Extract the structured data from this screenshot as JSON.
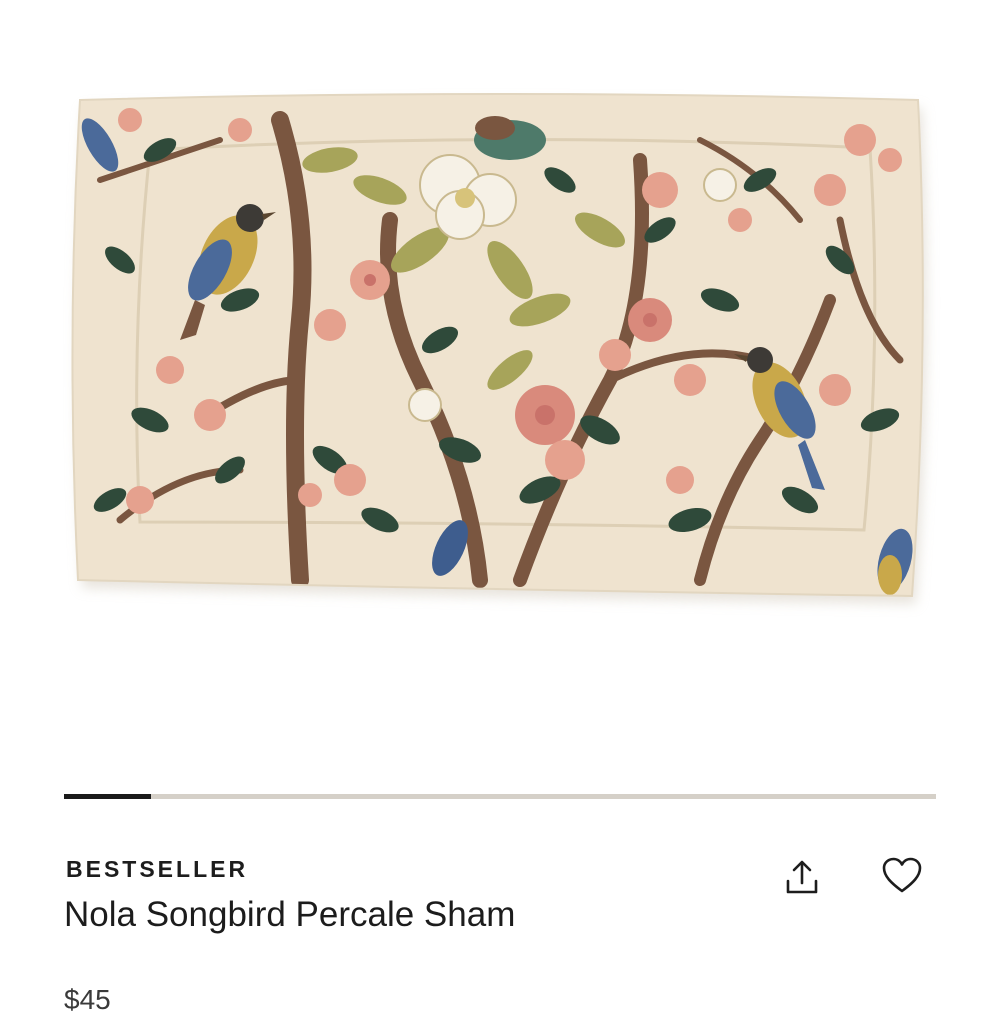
{
  "product": {
    "image_alt": "Nola Songbird Percale Sham",
    "badge": "BESTSELLER",
    "title": "Nola Songbird Percale Sham",
    "price": "$45"
  },
  "gallery": {
    "progress": 0.1
  },
  "actions": {
    "share_icon": "share-icon",
    "favorite_icon": "heart-icon"
  },
  "colors": {
    "fabric_base": "#efe3cf",
    "leaf_dark": "#2f4a3a",
    "leaf_olive": "#9a9a4a",
    "blossom_pink": "#e0a08c",
    "branch_brown": "#7a5640",
    "bird_blue": "#4b6a9a",
    "progress_track": "#d5d0c8",
    "progress_fill": "#1a1a1a"
  }
}
